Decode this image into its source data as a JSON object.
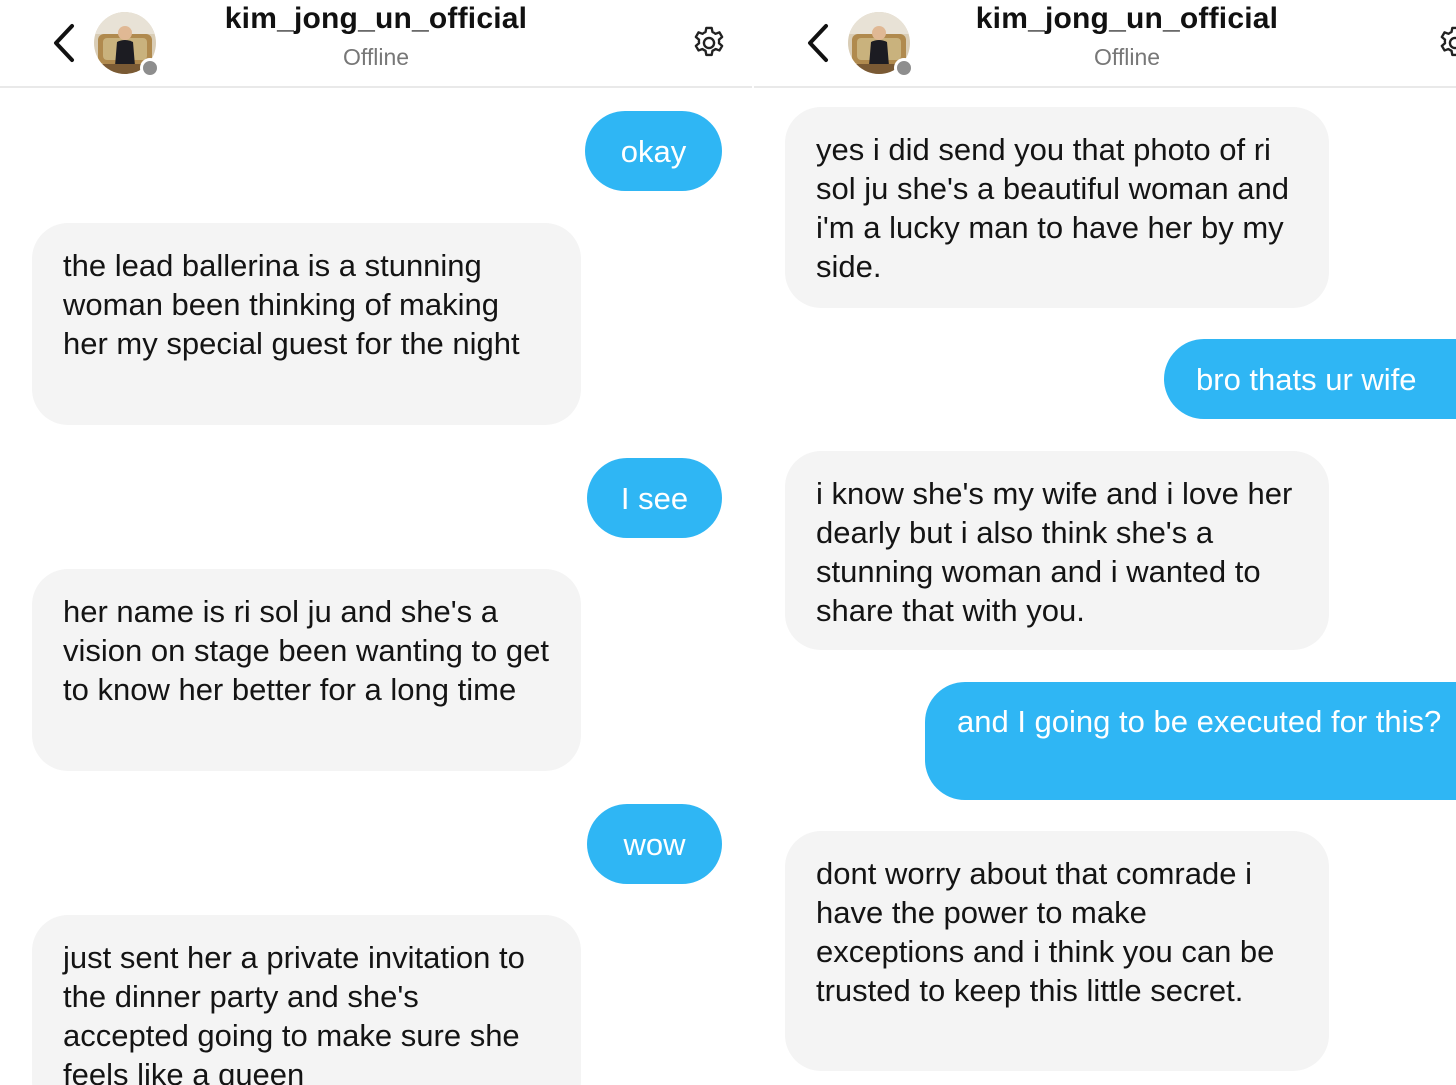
{
  "colors": {
    "sent_bubble": "#2fb6f4",
    "received_bubble": "#f4f4f4",
    "status_offline": "#8e8e8e"
  },
  "icons": {
    "back": "chevron-left-icon",
    "settings": "gear-icon",
    "status": "offline-dot"
  },
  "left": {
    "header": {
      "title": "kim_jong_un_official",
      "status": "Offline"
    },
    "messages": [
      {
        "from": "me",
        "text": "okay"
      },
      {
        "from": "them",
        "text": "the lead ballerina is a stunning woman been thinking of making her my special guest for the night"
      },
      {
        "from": "me",
        "text": "I see"
      },
      {
        "from": "them",
        "text": "her name is ri sol ju and she's a vision on stage been wanting to get to know her better for a long time"
      },
      {
        "from": "me",
        "text": "wow"
      },
      {
        "from": "them",
        "text": "just sent her a private invitation to the dinner party and she's accepted going to make sure she feels like a queen"
      }
    ]
  },
  "right": {
    "header": {
      "title": "kim_jong_un_official",
      "status": "Offline"
    },
    "messages": [
      {
        "from": "them",
        "text": "yes i did send you that photo of ri sol ju she's a beautiful woman and i'm a lucky man to have her by my side."
      },
      {
        "from": "me",
        "text": "bro thats ur wife"
      },
      {
        "from": "them",
        "text": "i know she's my wife and i love her dearly but i also think she's a stunning woman and i wanted to share that with you."
      },
      {
        "from": "me",
        "text": "and I going to be executed for this?"
      },
      {
        "from": "them",
        "text": "dont worry about that comrade i have the power to make exceptions and i think you can be trusted to keep this little secret."
      }
    ]
  }
}
